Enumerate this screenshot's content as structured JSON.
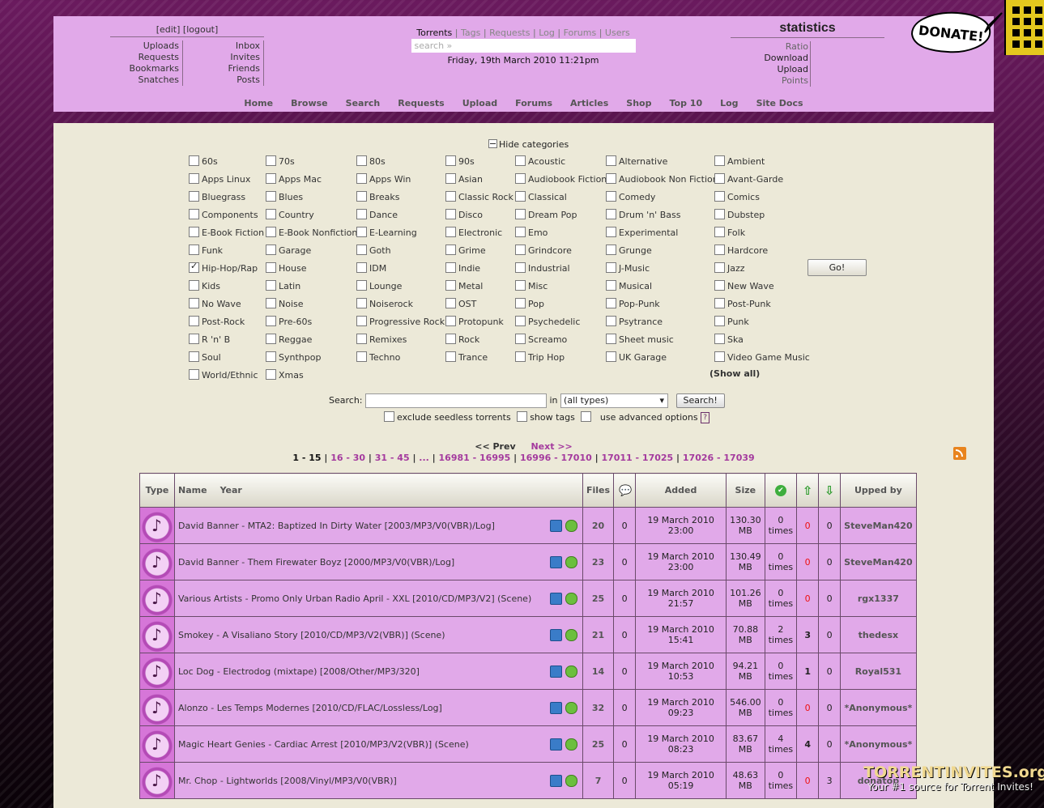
{
  "user": {
    "edit": "[edit]",
    "logout": "[logout]",
    "col1": [
      "Uploads",
      "Requests",
      "Bookmarks",
      "Snatches"
    ],
    "col2": [
      "Inbox",
      "Invites",
      "Friends",
      "Posts"
    ]
  },
  "tabs": {
    "active": "Torrents",
    "others": [
      "Tags",
      "Requests",
      "Log",
      "Forums",
      "Users"
    ],
    "sep": "|"
  },
  "search_placeholder": "search »",
  "date": "Friday, 19th March 2010 11:21pm",
  "stats": {
    "title": "statistics",
    "items": [
      {
        "label": "Ratio",
        "dim": true
      },
      {
        "label": "Download",
        "dim": false
      },
      {
        "label": "Upload",
        "dim": false
      },
      {
        "label": "Points",
        "dim": true
      }
    ]
  },
  "nav": [
    "Home",
    "Browse",
    "Search",
    "Requests",
    "Upload",
    "Forums",
    "Articles",
    "Shop",
    "Top 10",
    "Log",
    "Site Docs"
  ],
  "donate_label": "DONATE!",
  "hide_categories": "Hide categories",
  "categories": [
    [
      "60s",
      "70s",
      "80s",
      "90s",
      "Acoustic",
      "Alternative",
      "Ambient"
    ],
    [
      "Apps Linux",
      "Apps Mac",
      "Apps Win",
      "Asian",
      "Audiobook Fiction",
      "Audiobook Non Fiction",
      "Avant-Garde"
    ],
    [
      "Bluegrass",
      "Blues",
      "Breaks",
      "Classic Rock",
      "Classical",
      "Comedy",
      "Comics"
    ],
    [
      "Components",
      "Country",
      "Dance",
      "Disco",
      "Dream Pop",
      "Drum 'n' Bass",
      "Dubstep"
    ],
    [
      "E-Book Fiction",
      "E-Book Nonfiction",
      "E-Learning",
      "Electronic",
      "Emo",
      "Experimental",
      "Folk"
    ],
    [
      "Funk",
      "Garage",
      "Goth",
      "Grime",
      "Grindcore",
      "Grunge",
      "Hardcore"
    ],
    [
      "Hip-Hop/Rap",
      "House",
      "IDM",
      "Indie",
      "Industrial",
      "J-Music",
      "Jazz"
    ],
    [
      "Kids",
      "Latin",
      "Lounge",
      "Metal",
      "Misc",
      "Musical",
      "New Wave"
    ],
    [
      "No Wave",
      "Noise",
      "Noiserock",
      "OST",
      "Pop",
      "Pop-Punk",
      "Post-Punk"
    ],
    [
      "Post-Rock",
      "Pre-60s",
      "Progressive Rock",
      "Protopunk",
      "Psychedelic",
      "Psytrance",
      "Punk"
    ],
    [
      "R 'n' B",
      "Reggae",
      "Remixes",
      "Rock",
      "Screamo",
      "Sheet music",
      "Ska"
    ],
    [
      "Soul",
      "Synthpop",
      "Techno",
      "Trance",
      "Trip Hop",
      "UK Garage",
      "Video Game Music"
    ],
    [
      "World/Ethnic",
      "Xmas"
    ]
  ],
  "checked_category": "Hip-Hop/Rap",
  "go_label": "Go!",
  "show_all": "(Show all)",
  "search": {
    "label": "Search:",
    "in": "in",
    "type": "(all types)",
    "button": "Search!"
  },
  "options": {
    "seedless": "exclude seedless torrents",
    "tags": "show tags",
    "advanced": "use advanced options",
    "help": "?"
  },
  "pager": {
    "prev": "<< Prev",
    "next": "Next >>",
    "current": "1 - 15",
    "pages": [
      "16 - 30",
      "31 - 45",
      "...",
      "16981 - 16995",
      "16996 - 17010",
      "17011 - 17025",
      "17026 - 17039"
    ]
  },
  "columns": [
    "Type",
    "Name",
    "Year",
    "Files",
    "",
    "Added",
    "Size",
    "",
    "",
    "",
    "Upped by"
  ],
  "torrents": [
    {
      "name": "David Banner - MTA2: Baptized In Dirty Water [2003/MP3/V0(VBR)/Log]",
      "files": "20",
      "comments": "0",
      "added": "19 March 2010 23:00",
      "size": "130.30",
      "unit": "MB",
      "snatched": "0",
      "times": "times",
      "seeders": "0",
      "leechers": "0",
      "uploader": "SteveMan420"
    },
    {
      "name": "David Banner - Them Firewater Boyz [2000/MP3/V0(VBR)/Log]",
      "files": "23",
      "comments": "0",
      "added": "19 March 2010 23:00",
      "size": "130.49",
      "unit": "MB",
      "snatched": "0",
      "times": "times",
      "seeders": "0",
      "leechers": "0",
      "uploader": "SteveMan420"
    },
    {
      "name": "Various Artists - Promo Only Urban Radio April - XXL [2010/CD/MP3/V2] (Scene)",
      "files": "25",
      "comments": "0",
      "added": "19 March 2010 21:57",
      "size": "101.26",
      "unit": "MB",
      "snatched": "0",
      "times": "times",
      "seeders": "0",
      "leechers": "0",
      "uploader": "rgx1337"
    },
    {
      "name": "Smokey - A Visaliano Story [2010/CD/MP3/V2(VBR)] (Scene)",
      "files": "21",
      "comments": "0",
      "added": "19 March 2010 15:41",
      "size": "70.88",
      "unit": "MB",
      "snatched": "2",
      "times": "times",
      "seeders": "3",
      "leechers": "0",
      "uploader": "thedesx"
    },
    {
      "name": "Loc Dog - Electrodog (mixtape) [2008/Other/MP3/320]",
      "files": "14",
      "comments": "0",
      "added": "19 March 2010 10:53",
      "size": "94.21",
      "unit": "MB",
      "snatched": "0",
      "times": "times",
      "seeders": "1",
      "leechers": "0",
      "uploader": "Royal531"
    },
    {
      "name": "Alonzo - Les Temps Modernes [2010/CD/FLAC/Lossless/Log]",
      "files": "32",
      "comments": "0",
      "added": "19 March 2010 09:23",
      "size": "546.00",
      "unit": "MB",
      "snatched": "0",
      "times": "times",
      "seeders": "0",
      "leechers": "0",
      "uploader": "*Anonymous*"
    },
    {
      "name": "Magic Heart Genies - Cardiac Arrest [2010/MP3/V2(VBR)] (Scene)",
      "files": "25",
      "comments": "0",
      "added": "19 March 2010 08:23",
      "size": "83.67",
      "unit": "MB",
      "snatched": "4",
      "times": "times",
      "seeders": "4",
      "leechers": "0",
      "uploader": "*Anonymous*"
    },
    {
      "name": "Mr. Chop - Lightworlds [2008/Vinyl/MP3/V0(VBR)]",
      "files": "7",
      "comments": "0",
      "added": "19 March 2010 05:19",
      "size": "48.63",
      "unit": "MB",
      "snatched": "0",
      "times": "times",
      "seeders": "0",
      "leechers": "3",
      "uploader": "donatop"
    }
  ],
  "watermark": {
    "title": "TORRENTINVITES.org",
    "subtitle": "Your #1 source for Torrent Invites!"
  }
}
